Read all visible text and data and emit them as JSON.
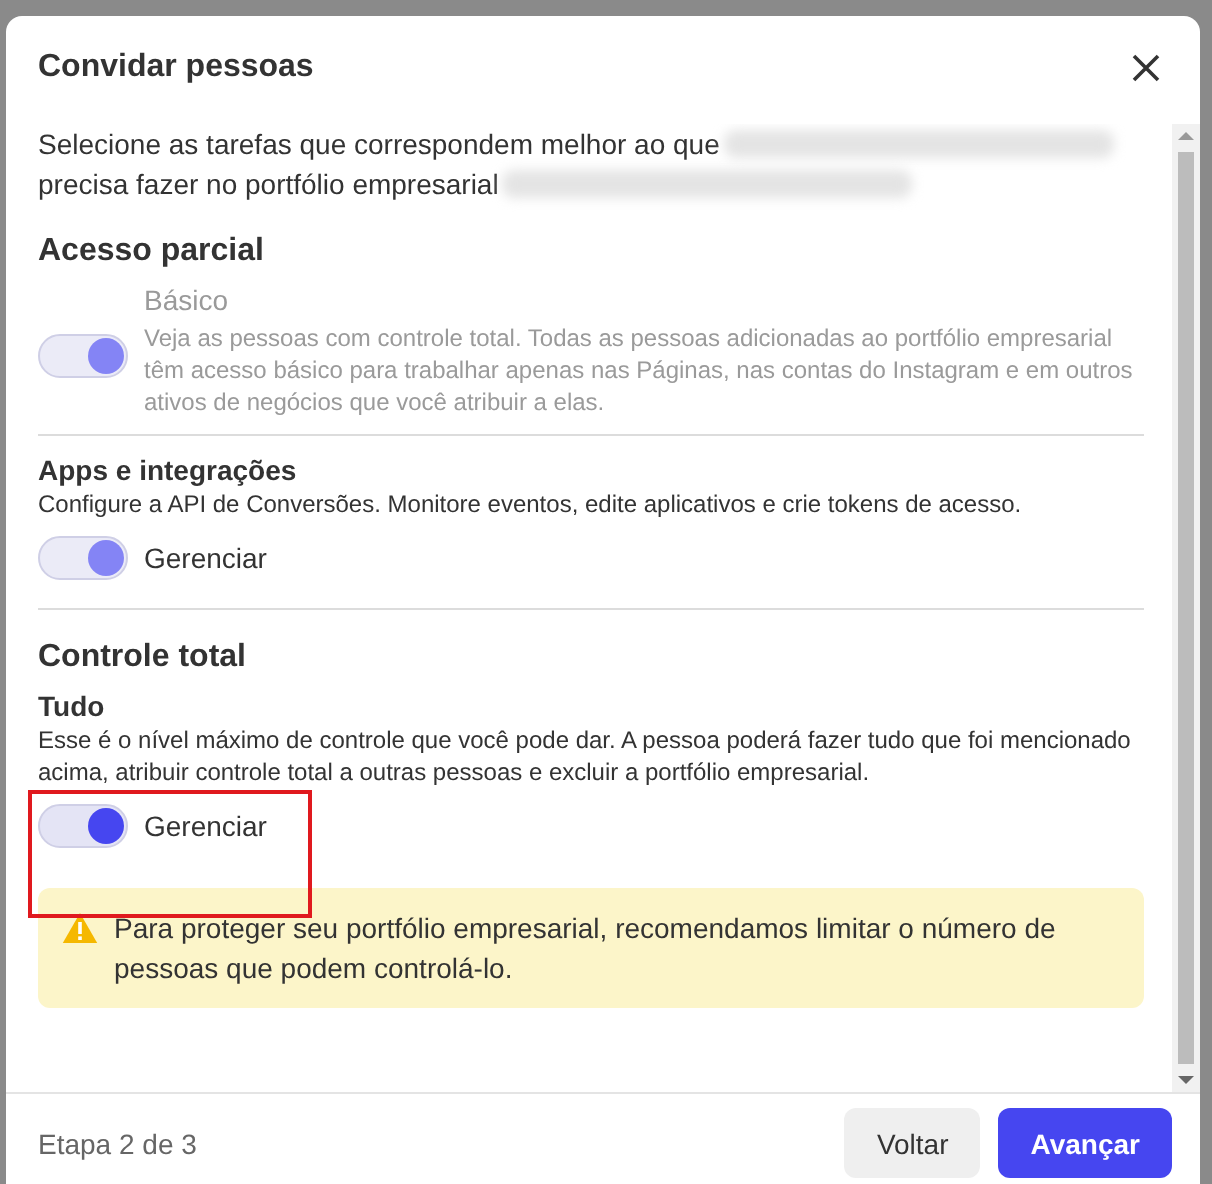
{
  "dialog": {
    "title": "Convidar pessoas",
    "intro": [
      "Selecione as tarefas que correspondem melhor ao que",
      "precisa fazer no portfólio empresarial"
    ],
    "sections": [
      {
        "heading": "Acesso parcial",
        "items": [
          {
            "kind": "inline",
            "title": "Básico",
            "description": "Veja as pessoas com controle total. Todas as pessoas adicionadas ao portfólio empresarial têm acesso básico para trabalhar apenas nas Páginas, nas contas do Instagram e em outros ativos de negócios que você atribuir a elas.",
            "toggle": {
              "on": true,
              "disabled": true
            },
            "highlighted": false
          },
          {
            "kind": "stacked",
            "title": "Apps e integrações",
            "description": "Configure a API de Conversões. Monitore eventos, edite aplicativos e crie tokens de acesso.",
            "toggle": {
              "label": "Gerenciar",
              "on": true,
              "disabled": true
            },
            "highlighted": false
          }
        ]
      },
      {
        "heading": "Controle total",
        "items": [
          {
            "kind": "stacked",
            "title": "Tudo",
            "description": "Esse é o nível máximo de controle que você pode dar. A pessoa poderá fazer tudo que foi mencionado acima, atribuir controle total a outras pessoas e excluir a portfólio empresarial.",
            "toggle": {
              "label": "Gerenciar",
              "on": true,
              "disabled": false
            },
            "highlighted": true
          }
        ],
        "warning": "Para proteger seu portfólio empresarial, recomendamos limitar o número de pessoas que podem controlá-lo."
      }
    ],
    "step": "Etapa 2 de 3",
    "buttons": [
      {
        "label": "Voltar",
        "kind": "secondary"
      },
      {
        "label": "Avançar",
        "kind": "primary"
      }
    ]
  }
}
